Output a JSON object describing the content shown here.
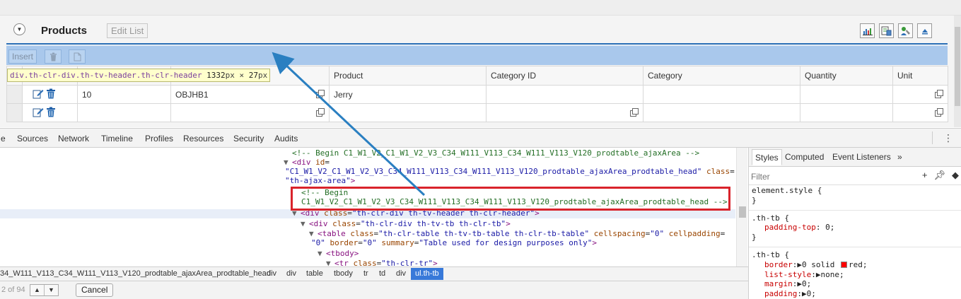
{
  "panel": {
    "title": "Products",
    "edit_list_label": "Edit List",
    "tool_icons": [
      "chart-icon",
      "export-icon",
      "settings-icon",
      "collapse-icon"
    ]
  },
  "toolbar": {
    "insert_label": "Insert",
    "delete_icon": "trash-icon",
    "copy_icon": "copy-icon"
  },
  "tooltip": {
    "selector": "div.th-clr-div.th-tv-header.th-clr-header",
    "width": "1332",
    "width_unit": "px",
    "times": "×",
    "height": "27",
    "height_unit": "px"
  },
  "table": {
    "headers": [
      "Product",
      "Category ID",
      "Category",
      "Quantity",
      "Unit"
    ],
    "rows": [
      {
        "item": "10",
        "product_id": "OBJHB1",
        "product": "Jerry",
        "category_id": "",
        "category": "",
        "quantity": "",
        "unit": ""
      },
      {
        "item": "",
        "product_id": "",
        "product": "",
        "category_id": "",
        "category": "",
        "quantity": "",
        "unit": ""
      }
    ]
  },
  "devtools": {
    "tabs": [
      "e",
      "Sources",
      "Network",
      "Timeline",
      "Profiles",
      "Resources",
      "Security",
      "Audits"
    ],
    "breadcrumbs": [
      "34_W111_V113_C34_W111_V113_V120_prodtable_ajaxArea_prodtable_head",
      "div",
      "div",
      "table",
      "tbody",
      "tr",
      "td",
      "div"
    ],
    "breadcrumb_active": "ul.th-tb",
    "find_count": "2 of 94",
    "cancel_label": "Cancel",
    "elements": {
      "line1": "<!-- Begin C1_W1_V2_C1_W1_V2_V3_C34_W111_V113_C34_W111_V113_V120_prodtable_ajaxArea -->",
      "line2_tag": "<div",
      "line2_attr": "id",
      "line2_eq": "=",
      "line3_val": "\"C1_W1_V2_C1_W1_V2_V3_C34_W111_V113_C34_W111_V113_V120_prodtable_ajaxArea_prodtable_head\"",
      "line3_attr": "class",
      "line3_eq": "=",
      "line4_val": "\"th-ajax-area\"",
      "line4_end": ">",
      "line5": "<!-- Begin",
      "line6": "C1_W1_V2_C1_W1_V2_V3_C34_W111_V113_C34_W111_V113_V120_prodtable_ajaxArea_prodtable_head -->",
      "line7_tag": "<div",
      "line7_attr": "class",
      "line7_val": "\"th-clr-div th-tv-header th-clr-header\"",
      "line7_end": ">",
      "line8_tag": "<div",
      "line8_attr": "class",
      "line8_val": "\"th-clr-div th-tv-tb th-clr-tb\"",
      "line8_end": ">",
      "line9_tag": "<table",
      "line9_a1": "class",
      "line9_v1": "\"th-clr-table th-tv-tb-table th-clr-tb-table\"",
      "line9_a2": "cellspacing",
      "line9_v2": "\"0\"",
      "line9_a3": "cellpadding",
      "line9_eq": "=",
      "line10_v3": "\"0\"",
      "line10_a4": "border",
      "line10_v4": "\"0\"",
      "line10_a5": "summary",
      "line10_v5": "\"Table used for design purposes only\"",
      "line10_end": ">",
      "line11": "<tbody>",
      "line12_tag": "<tr",
      "line12_attr": "class",
      "line12_val": "\"th-clr-tr\"",
      "line12_end": ">"
    }
  },
  "styles": {
    "tabs": [
      "Styles",
      "Computed",
      "Event Listeners",
      "»"
    ],
    "filter_placeholder": "Filter",
    "rules": [
      {
        "selector": "element.style {",
        "close": "}",
        "props": []
      },
      {
        "selector": ".th-tb {",
        "close": "}",
        "props": [
          {
            "name": "padding-top",
            "value": "0;"
          }
        ]
      },
      {
        "selector": ".th-tb {",
        "close": "",
        "props": [
          {
            "name": "border",
            "value": "0 solid",
            "extra": "red;"
          },
          {
            "name": "list-style",
            "value": "none;"
          },
          {
            "name": "margin",
            "value": "0;"
          },
          {
            "name": "padding",
            "value": "0;"
          }
        ]
      }
    ],
    "colors": {
      "swatch": "#ff0000"
    }
  },
  "colors": {
    "toolbar_blue": "#a9c8ec",
    "header_line": "#2b6fb6",
    "highlight_box": "#d9232b",
    "arrow": "#2a7fc1",
    "breadcrumb_active": "#3879d9"
  }
}
